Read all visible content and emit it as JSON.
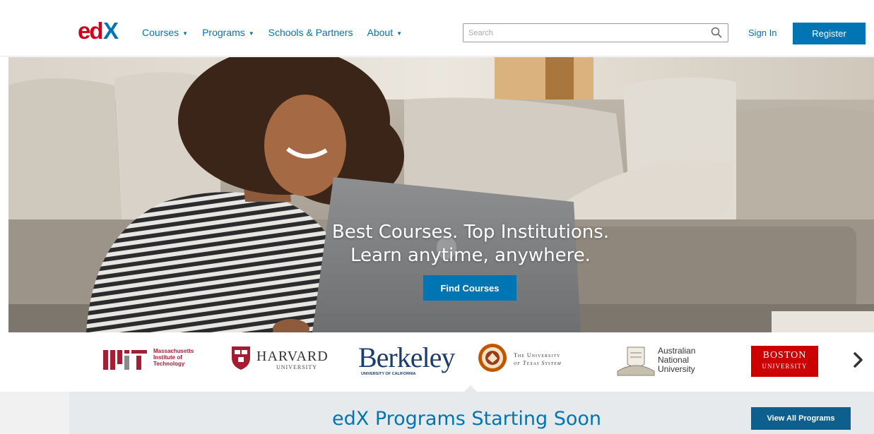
{
  "header": {
    "logo_alt": "edX",
    "nav": [
      {
        "label": "Courses",
        "has_dropdown": true
      },
      {
        "label": "Programs",
        "has_dropdown": true
      },
      {
        "label": "Schools & Partners",
        "has_dropdown": false
      },
      {
        "label": "About",
        "has_dropdown": true
      }
    ],
    "search_placeholder": "Search",
    "search_icon": "search-icon",
    "signin_label": "Sign In",
    "register_label": "Register"
  },
  "hero": {
    "headline_line1": "Best Courses. Top Institutions.",
    "headline_line2": "Learn anytime, anywhere.",
    "cta_label": "Find Courses"
  },
  "partners": {
    "mit": {
      "line1": "Massachusetts",
      "line2": "Institute of",
      "line3": "Technology"
    },
    "harvard": {
      "name": "HARVARD",
      "sub": "UNIVERSITY"
    },
    "berkeley": {
      "name": "Berkeley",
      "sub": "UNIVERSITY OF CALIFORNIA"
    },
    "texas": {
      "line1": "The University",
      "line2": "of Texas System"
    },
    "anu": {
      "line1": "Australian",
      "line2": "National",
      "line3": "University"
    },
    "boston": {
      "line1": "BOSTON",
      "line2": "UNIVERSITY"
    },
    "next_icon": "chevron-right-icon"
  },
  "programs": {
    "title": "edX Programs Starting Soon",
    "view_all_label": "View All Programs"
  },
  "colors": {
    "brand_blue": "#0075b4",
    "dark_blue": "#0d5f8e",
    "mit_red": "#a31f34",
    "bu_red": "#cc0000",
    "banner_bg": "#e6eaed"
  }
}
